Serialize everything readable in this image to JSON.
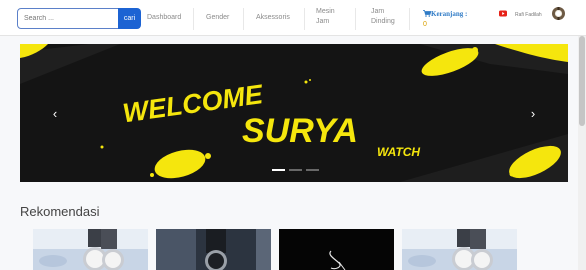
{
  "navbar": {
    "search_placeholder": "Search ...",
    "search_button": "cari",
    "links": [
      "Dashboard",
      "Gender",
      "Aksessoris",
      "Mesin\nJam",
      "Jam\nDinding"
    ],
    "cart_label": "Keranjang :",
    "cart_count": "0",
    "user_name": "Rafi Fadilah",
    "colors": {
      "search_button": "#1c63d3",
      "cart": "#2f7bc6"
    }
  },
  "banner": {
    "line1": "WELCOME",
    "line2": "SURYA",
    "line3": "WATCH",
    "prev_icon": "chevron-left-icon",
    "next_icon": "chevron-right-icon",
    "active_slide": 1,
    "slides": 3,
    "colors": {
      "text": "#f5e60d",
      "background": "#141414"
    }
  },
  "section_title": "Rekomendasi"
}
